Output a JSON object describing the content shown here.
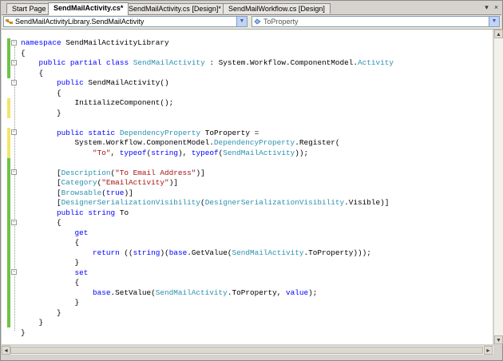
{
  "tabs": [
    {
      "label": "Start Page",
      "active": false
    },
    {
      "label": "SendMailActivity.cs*",
      "active": true
    },
    {
      "label": "SendMailActivity.cs [Design]*",
      "active": false
    },
    {
      "label": "SendMailWorkflow.cs [Design]",
      "active": false
    }
  ],
  "tab_controls": {
    "menu": "▾",
    "close": "×"
  },
  "nav": {
    "type_dropdown": "SendMailActivityLibrary.SendMailActivity",
    "member_dropdown": "ToProperty",
    "arrow": "▼"
  },
  "editor": {
    "lines": [
      [
        {
          "t": "namespace",
          "c": "kw"
        },
        {
          "t": " SendMailActivityLibrary"
        }
      ],
      [
        {
          "t": "{"
        }
      ],
      [
        {
          "t": "    "
        },
        {
          "t": "public",
          "c": "kw"
        },
        {
          "t": " "
        },
        {
          "t": "partial",
          "c": "kw"
        },
        {
          "t": " "
        },
        {
          "t": "class",
          "c": "kw"
        },
        {
          "t": " "
        },
        {
          "t": "SendMailActivity",
          "c": "ty"
        },
        {
          "t": " : System.Workflow.ComponentModel."
        },
        {
          "t": "Activity",
          "c": "ty"
        }
      ],
      [
        {
          "t": "    {"
        }
      ],
      [
        {
          "t": "        "
        },
        {
          "t": "public",
          "c": "kw"
        },
        {
          "t": " SendMailActivity()"
        }
      ],
      [
        {
          "t": "        {"
        }
      ],
      [
        {
          "t": "            InitializeComponent();"
        }
      ],
      [
        {
          "t": "        }"
        }
      ],
      [
        {
          "t": ""
        }
      ],
      [
        {
          "t": "        "
        },
        {
          "t": "public",
          "c": "kw"
        },
        {
          "t": " "
        },
        {
          "t": "static",
          "c": "kw"
        },
        {
          "t": " "
        },
        {
          "t": "DependencyProperty",
          "c": "ty"
        },
        {
          "t": " ToProperty ="
        }
      ],
      [
        {
          "t": "            System.Workflow.ComponentModel."
        },
        {
          "t": "DependencyProperty",
          "c": "ty"
        },
        {
          "t": ".Register("
        }
      ],
      [
        {
          "t": "                "
        },
        {
          "t": "\"To\"",
          "c": "st"
        },
        {
          "t": ", "
        },
        {
          "t": "typeof",
          "c": "kw"
        },
        {
          "t": "("
        },
        {
          "t": "string",
          "c": "kw"
        },
        {
          "t": "), "
        },
        {
          "t": "typeof",
          "c": "kw"
        },
        {
          "t": "("
        },
        {
          "t": "SendMailActivity",
          "c": "ty"
        },
        {
          "t": "));"
        }
      ],
      [
        {
          "t": ""
        }
      ],
      [
        {
          "t": "        ["
        },
        {
          "t": "Description",
          "c": "ty"
        },
        {
          "t": "("
        },
        {
          "t": "\"To Email Address\"",
          "c": "st"
        },
        {
          "t": ")]"
        }
      ],
      [
        {
          "t": "        ["
        },
        {
          "t": "Category",
          "c": "ty"
        },
        {
          "t": "("
        },
        {
          "t": "\"EmailActivity\"",
          "c": "st"
        },
        {
          "t": ")]"
        }
      ],
      [
        {
          "t": "        ["
        },
        {
          "t": "Browsable",
          "c": "ty"
        },
        {
          "t": "("
        },
        {
          "t": "true",
          "c": "kw"
        },
        {
          "t": ")]"
        }
      ],
      [
        {
          "t": "        ["
        },
        {
          "t": "DesignerSerializationVisibility",
          "c": "ty"
        },
        {
          "t": "("
        },
        {
          "t": "DesignerSerializationVisibility",
          "c": "ty"
        },
        {
          "t": ".Visible)]"
        }
      ],
      [
        {
          "t": "        "
        },
        {
          "t": "public",
          "c": "kw"
        },
        {
          "t": " "
        },
        {
          "t": "string",
          "c": "kw"
        },
        {
          "t": " To"
        }
      ],
      [
        {
          "t": "        {"
        }
      ],
      [
        {
          "t": "            "
        },
        {
          "t": "get",
          "c": "kw"
        }
      ],
      [
        {
          "t": "            {"
        }
      ],
      [
        {
          "t": "                "
        },
        {
          "t": "return",
          "c": "kw"
        },
        {
          "t": " (("
        },
        {
          "t": "string",
          "c": "kw"
        },
        {
          "t": ")("
        },
        {
          "t": "base",
          "c": "kw"
        },
        {
          "t": ".GetValue("
        },
        {
          "t": "SendMailActivity",
          "c": "ty"
        },
        {
          "t": ".ToProperty)));"
        }
      ],
      [
        {
          "t": "            }"
        }
      ],
      [
        {
          "t": "            "
        },
        {
          "t": "set",
          "c": "kw"
        }
      ],
      [
        {
          "t": "            {"
        }
      ],
      [
        {
          "t": "                "
        },
        {
          "t": "base",
          "c": "kw"
        },
        {
          "t": ".SetValue("
        },
        {
          "t": "SendMailActivity",
          "c": "ty"
        },
        {
          "t": ".ToProperty, "
        },
        {
          "t": "value",
          "c": "kw"
        },
        {
          "t": ");"
        }
      ],
      [
        {
          "t": "            }"
        }
      ],
      [
        {
          "t": "        }"
        }
      ],
      [
        {
          "t": "    }"
        }
      ],
      [
        {
          "t": "}"
        }
      ]
    ]
  },
  "scroll": {
    "up": "▲",
    "down": "▼",
    "left": "◄",
    "right": "►"
  },
  "colors": {
    "keyword": "#0000ff",
    "type": "#2b91af",
    "string": "#a31515",
    "saved_change": "#6cc24a",
    "unsaved_change": "#f2e56b"
  }
}
